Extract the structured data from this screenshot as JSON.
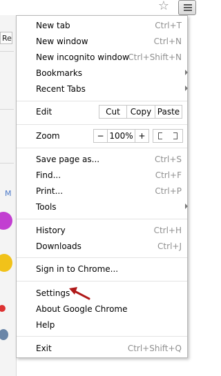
{
  "background": {
    "tab_fragment": "Re",
    "link_fragment": "M"
  },
  "toolbar": {
    "bookmark_star": "star-icon",
    "menu_button": "hamburger-menu-icon"
  },
  "menu": {
    "groups": [
      {
        "items": [
          {
            "label": "New tab",
            "shortcut": "Ctrl+T"
          },
          {
            "label": "New window",
            "shortcut": "Ctrl+N"
          },
          {
            "label": "New incognito window",
            "shortcut": "Ctrl+Shift+N"
          },
          {
            "label": "Bookmarks",
            "submenu": true
          },
          {
            "label": "Recent Tabs",
            "submenu": true
          }
        ]
      },
      {
        "edit": {
          "label": "Edit",
          "cut": "Cut",
          "copy": "Copy",
          "paste": "Paste"
        }
      },
      {
        "zoom": {
          "label": "Zoom",
          "minus": "−",
          "level": "100%",
          "plus": "+"
        }
      },
      {
        "items": [
          {
            "label": "Save page as...",
            "shortcut": "Ctrl+S"
          },
          {
            "label": "Find...",
            "shortcut": "Ctrl+F"
          },
          {
            "label": "Print...",
            "shortcut": "Ctrl+P"
          },
          {
            "label": "Tools",
            "submenu": true
          }
        ]
      },
      {
        "items": [
          {
            "label": "History",
            "shortcut": "Ctrl+H"
          },
          {
            "label": "Downloads",
            "shortcut": "Ctrl+J"
          }
        ]
      },
      {
        "items": [
          {
            "label": "Sign in to Chrome..."
          }
        ]
      },
      {
        "items": [
          {
            "label": "Settings"
          },
          {
            "label": "About Google Chrome"
          },
          {
            "label": "Help"
          }
        ]
      },
      {
        "items": [
          {
            "label": "Exit",
            "shortcut": "Ctrl+Shift+Q"
          }
        ]
      }
    ]
  },
  "annotation": {
    "arrow_color": "#b01919"
  },
  "colors": {
    "shortcut_text": "#8f8f8f",
    "separator": "#e3e3e3"
  }
}
